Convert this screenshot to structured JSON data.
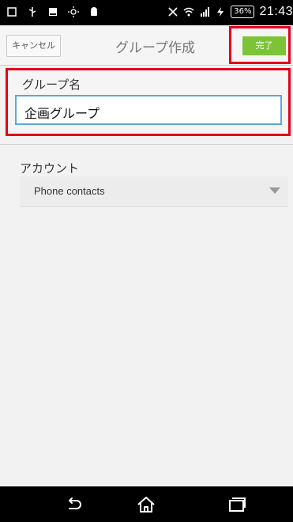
{
  "status_bar": {
    "icons": [
      "square-notification-icon",
      "usb-icon",
      "image-icon",
      "sun-icon",
      "android-icon",
      "mute-icon",
      "wifi-icon",
      "signal-4g-icon",
      "charging-icon"
    ],
    "battery": "36%",
    "time": "21:43"
  },
  "action_bar": {
    "cancel_label": "キャンセル",
    "title": "グループ作成",
    "done_label": "完了"
  },
  "form": {
    "group_name_label": "グループ名",
    "group_name_value": "企画グループ",
    "account_label": "アカウント",
    "account_value": "Phone contacts"
  },
  "nav_bar": {
    "icons": [
      "back-icon",
      "home-icon",
      "recent-apps-icon"
    ]
  },
  "colors": {
    "highlight": "#e3001b",
    "done_button": "#7cc338",
    "input_focus": "#5aa6e0"
  }
}
